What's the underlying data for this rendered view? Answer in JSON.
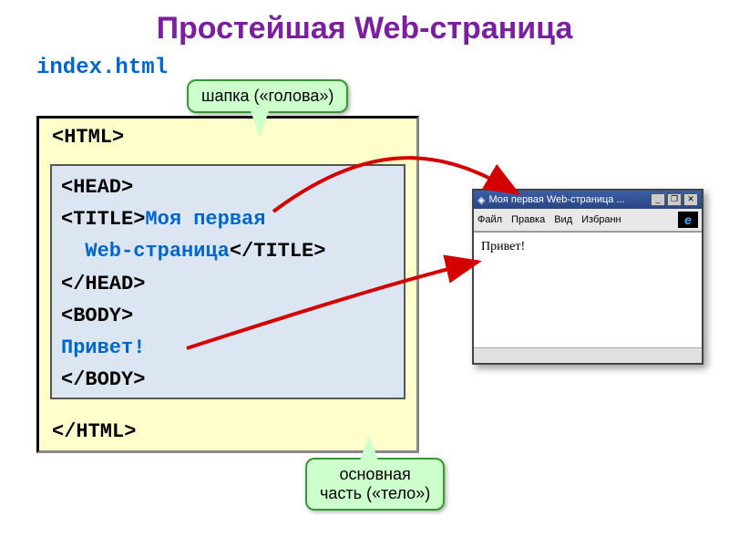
{
  "title": "Простейшая Web-страница",
  "filename": "index.html",
  "code": {
    "html_open": "<HTML>",
    "head_open": "<HEAD>",
    "title_open": "<TITLE>",
    "title_text1": "Моя первая",
    "title_text2": "Web-страница",
    "title_close": "</TITLE>",
    "head_close": "</HEAD>",
    "body_open": "<BODY>",
    "body_text": "Привет!",
    "body_close": "</BODY>",
    "html_close": "</HTML>"
  },
  "callouts": {
    "head": "шапка («голова»)",
    "body_l1": "основная",
    "body_l2": "часть («тело»)"
  },
  "browser": {
    "window_title": "Моя первая Web-страница ...",
    "menu": {
      "file": "Файл",
      "edit": "Правка",
      "view": "Вид",
      "fav": "Избранн"
    },
    "content": "Привет!",
    "btn_min": "_",
    "btn_max": "❐",
    "btn_close": "✕"
  }
}
